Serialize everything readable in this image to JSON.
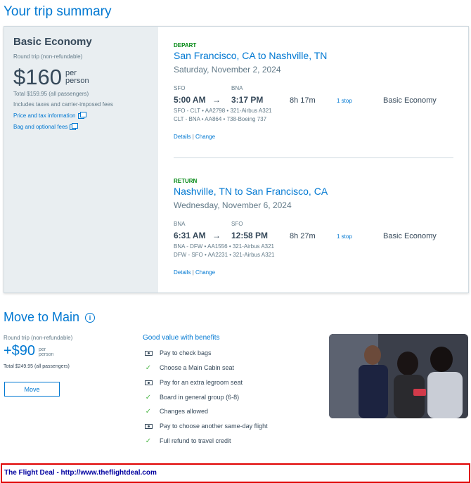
{
  "page": {
    "title": "Your trip summary"
  },
  "fare": {
    "name": "Basic Economy",
    "trip_type": "Round trip (non-refundable)",
    "price": "$160",
    "per_1": "per",
    "per_2": "person",
    "total": "Total $159.95 (all passengers)",
    "includes": "Includes taxes and carrier-imposed fees",
    "price_link": "Price and tax information",
    "bag_link": "Bag and optional fees"
  },
  "depart": {
    "label": "DEPART",
    "route": "San Francisco, CA to Nashville, TN",
    "date": "Saturday, November 2, 2024",
    "from_code": "SFO",
    "to_code": "BNA",
    "dep_time": "5:00 AM",
    "arrow": "→",
    "arr_time": "3:17 PM",
    "duration": "8h 17m",
    "stops": "1 stop",
    "cabin": "Basic Economy",
    "flight1": "SFO - CLT • AA2798 • 321-Airbus A321",
    "flight2": "CLT - BNA • AA864 • 738-Boeing 737",
    "details": "Details",
    "sep": "|",
    "change": "Change"
  },
  "return": {
    "label": "RETURN",
    "route": "Nashville, TN to San Francisco, CA",
    "date": "Wednesday, November 6, 2024",
    "from_code": "BNA",
    "to_code": "SFO",
    "dep_time": "6:31 AM",
    "arrow": "→",
    "arr_time": "12:58 PM",
    "duration": "8h 27m",
    "stops": "1 stop",
    "cabin": "Basic Economy",
    "flight1": "BNA - DFW • AA1556 • 321-Airbus A321",
    "flight2": "DFW - SFO • AA2231 • 321-Airbus A321",
    "details": "Details",
    "sep": "|",
    "change": "Change"
  },
  "upsell": {
    "title": "Move to Main",
    "info_icon": "i",
    "trip_type": "Round trip (non-refundable)",
    "price": "+$90",
    "per_1": "per",
    "per_2": "person",
    "total": "Total $249.95 (all passengers)",
    "move_label": "Move",
    "benefits_title": "Good value with benefits",
    "benefits": [
      {
        "icon": "money-icon",
        "text": "Pay to check bags"
      },
      {
        "icon": "check-icon",
        "text": "Choose a Main Cabin seat"
      },
      {
        "icon": "money-icon",
        "text": "Pay for an extra legroom seat"
      },
      {
        "icon": "check-icon",
        "text": "Board in general group (6-8)"
      },
      {
        "icon": "check-icon",
        "text": "Changes allowed"
      },
      {
        "icon": "money-icon",
        "text": "Pay to choose another same-day flight"
      },
      {
        "icon": "check-icon",
        "text": "Full refund to travel credit"
      }
    ]
  },
  "footer": {
    "text": "The Flight Deal - http://www.theflightdeal.com"
  },
  "colors": {
    "accent": "#0078d2",
    "green": "#008712",
    "footer_border": "#e00000"
  }
}
